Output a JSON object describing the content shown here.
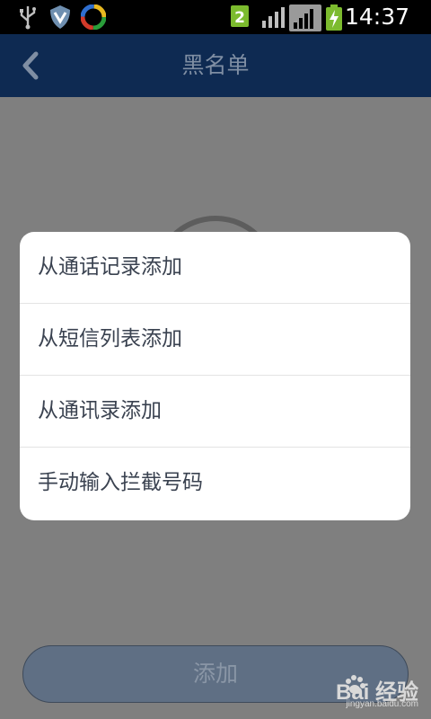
{
  "statusbar": {
    "icons": [
      "usb-icon",
      "shield-icon",
      "swirl-app-icon",
      "sim-2-icon",
      "signal-icon",
      "signal-icon",
      "battery-charging-icon"
    ],
    "sim_label": "2",
    "time": "14:37"
  },
  "appbar": {
    "title": "黑名单",
    "back_icon": "chevron-left-icon",
    "color": "#0e2a52"
  },
  "menu": {
    "items": [
      {
        "label": "从通话记录添加"
      },
      {
        "label": "从短信列表添加"
      },
      {
        "label": "从通讯录添加"
      },
      {
        "label": "手动输入拦截号码"
      }
    ]
  },
  "footer": {
    "add_label": "添加"
  },
  "watermark": {
    "main": "Bai 经验",
    "sub": "jingyan.baidu.com"
  }
}
